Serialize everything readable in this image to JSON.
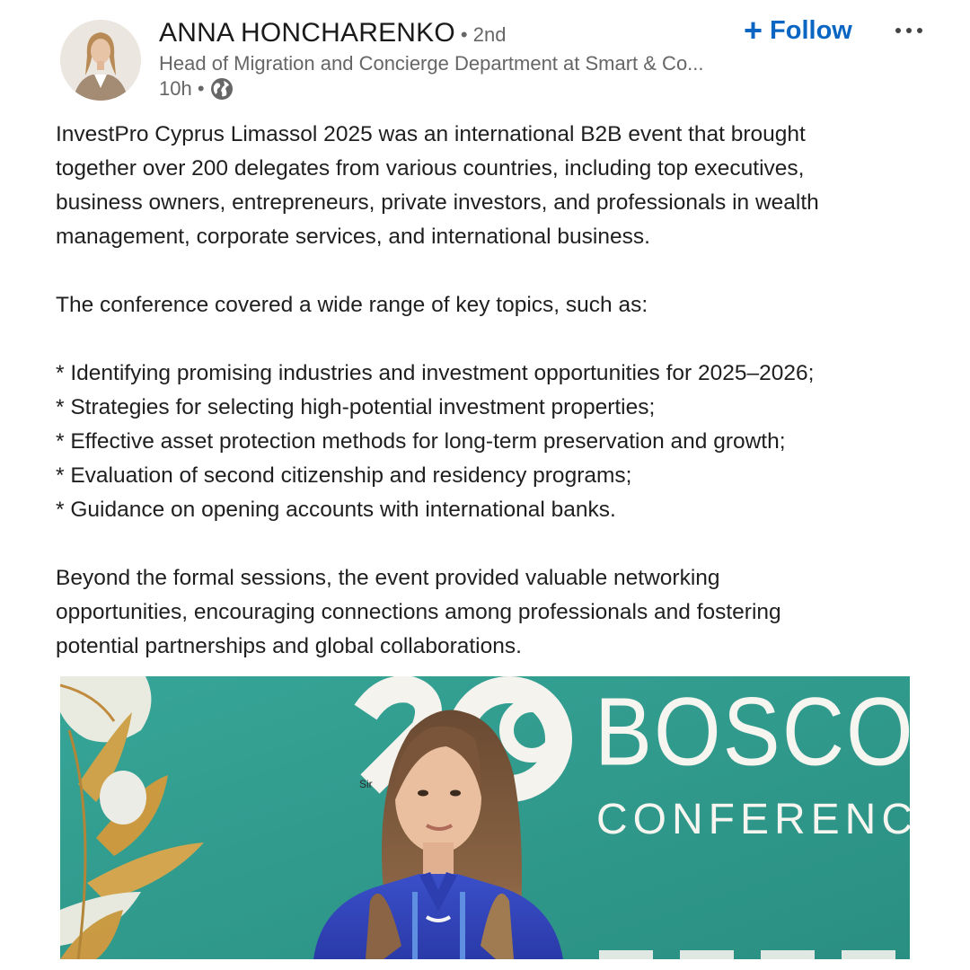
{
  "post": {
    "author": {
      "name": "ANNA HONCHARENKO",
      "degree": "• 2nd",
      "headline": "Head of Migration and Concierge Department at Smart & Co...",
      "time": "10h •",
      "visibility_icon": "globe-icon"
    },
    "follow_label": "Follow",
    "more_icon": "more-horizontal-icon",
    "text": {
      "p1": [
        "InvestPro Cyprus Limassol 2025 was an international B2B event that brought",
        "together over 200 delegates from various countries, including top executives,",
        "business owners, entrepreneurs, private investors, and professionals in wealth",
        "management, corporate services, and international business."
      ],
      "p2": "The conference covered a wide range of key topics, such as:",
      "bullets": [
        "* Identifying promising industries and investment opportunities for 2025–2026;",
        "* Strategies for selecting high-potential investment properties;",
        "* Effective asset protection methods for long-term preservation and growth;",
        "* Evaluation of second citizenship and residency programs;",
        "* Guidance on opening accounts with international banks."
      ],
      "p3": [
        "Beyond the formal sessions, the event provided valuable networking",
        "opportunities, encouraging connections among professionals and fostering",
        "potential partnerships and global collaborations."
      ]
    },
    "image": {
      "banner_word": "BOSCO",
      "banner_sub": "CONFERENCE",
      "small_text": "Sir"
    }
  },
  "colors": {
    "accent": "#0a66c2",
    "muted": "#666666",
    "banner_teal": "#2f9a8c"
  }
}
